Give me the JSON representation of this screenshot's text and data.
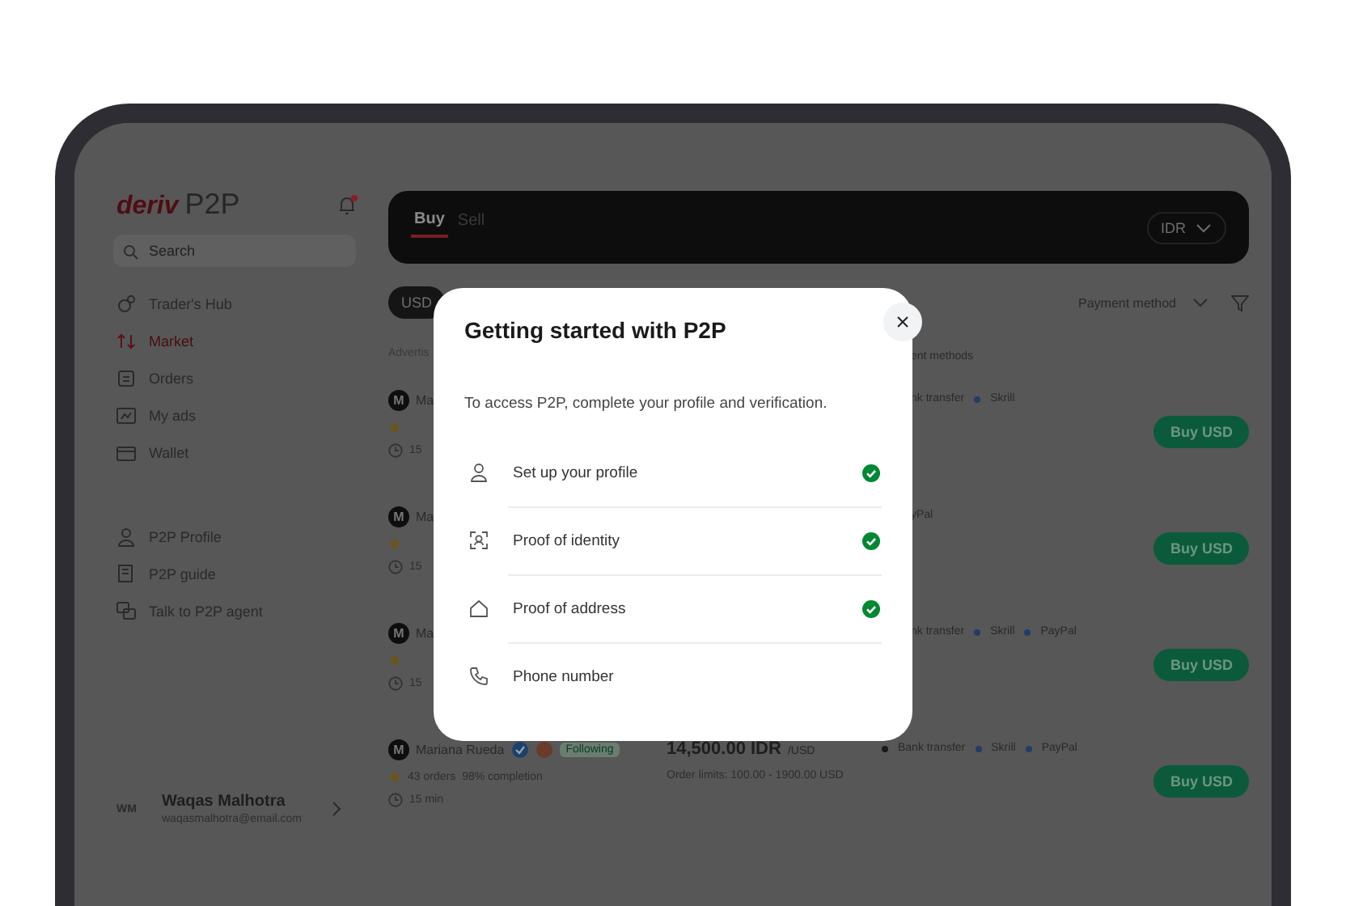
{
  "logo": {
    "brand": "deriv",
    "product": "P2P"
  },
  "notifications": {
    "unread": true
  },
  "search": {
    "placeholder": "Search"
  },
  "nav": [
    {
      "label": "Trader's Hub",
      "kind": "hub",
      "selected": false
    },
    {
      "label": "Market",
      "kind": "market",
      "selected": true
    },
    {
      "label": "Orders",
      "kind": "orders",
      "selected": false
    },
    {
      "label": "My ads",
      "kind": "ads",
      "selected": false
    },
    {
      "label": "Wallet",
      "kind": "wallet",
      "selected": false
    }
  ],
  "help_links": [
    {
      "label": "P2P Profile",
      "kind": "profile"
    },
    {
      "label": "P2P guide",
      "kind": "guide"
    },
    {
      "label": "Talk to P2P agent",
      "kind": "chat"
    }
  ],
  "user": {
    "initials": "WM",
    "name": "Waqas Malhotra",
    "email": "waqasmalhotra@email.com"
  },
  "trade_tabs": [
    {
      "label": "Buy",
      "selected": true
    },
    {
      "label": "Sell",
      "selected": false
    }
  ],
  "currency_select": {
    "value": "IDR"
  },
  "filters": {
    "currency": "USD",
    "payment_method": "Payment method"
  },
  "table": {
    "columns": [
      "Advertis",
      "ent methods"
    ],
    "rows": [
      {
        "avatar": "M",
        "name": "Ma",
        "time": "15",
        "methods": [
          {
            "label": "nk transfer",
            "dot": false
          },
          {
            "label": "Skrill",
            "dot": true
          }
        ],
        "button": "Buy USD"
      },
      {
        "avatar": "M",
        "name": "Ma",
        "time": "15",
        "methods": [
          {
            "label": "yPal",
            "dot": false
          }
        ],
        "button": "Buy USD"
      },
      {
        "avatar": "M",
        "name": "Ma",
        "time": "15",
        "methods": [
          {
            "label": "nk transfer",
            "dot": false
          },
          {
            "label": "Skrill",
            "dot": true
          },
          {
            "label": "PayPal",
            "dot": true
          }
        ],
        "button": "Buy USD"
      },
      {
        "avatar": "M",
        "name": "Mariana Rueda",
        "verified": true,
        "following": "Following",
        "orders": "43 orders",
        "completion": "98% completion",
        "time": "15 min",
        "price": "14,500.00 IDR",
        "price_unit": "/USD",
        "limits": "Order limits: 100.00 - 1900.00 USD",
        "methods": [
          {
            "label": "Bank transfer",
            "dot": true
          },
          {
            "label": "Skrill",
            "dot": true
          },
          {
            "label": "PayPal",
            "dot": true
          }
        ],
        "button": "Buy USD"
      }
    ]
  },
  "modal": {
    "title": "Getting started with P2P",
    "description": "To access P2P, complete your profile and verification.",
    "steps": [
      {
        "label": "Set up your profile",
        "kind": "profile",
        "done": true
      },
      {
        "label": "Proof of identity",
        "kind": "identity",
        "done": true
      },
      {
        "label": "Proof of address",
        "kind": "address",
        "done": true
      },
      {
        "label": "Phone number",
        "kind": "phone",
        "done": false
      }
    ]
  }
}
